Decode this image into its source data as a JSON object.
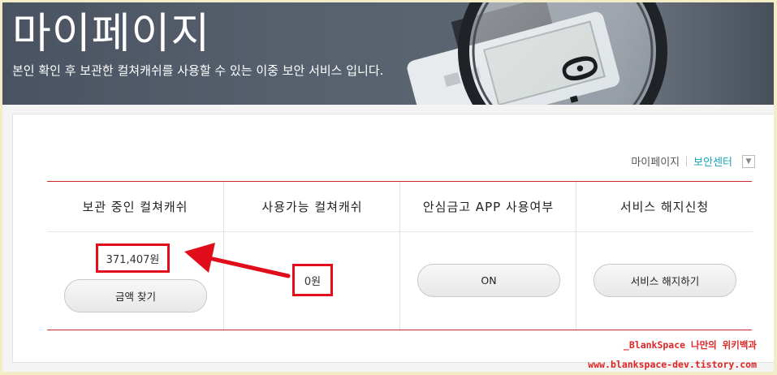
{
  "banner": {
    "title": "마이페이지",
    "subtitle": "본인 확인 후 보관한 컬쳐캐쉬를 사용할 수 있는 이중 보안 서비스 입니다.",
    "calculator_display": "0."
  },
  "breadcrumb": {
    "home": "마이페이지",
    "current": "보안센터",
    "menu_icon": "chevron-down-icon"
  },
  "table": {
    "headers": [
      "보관 중인 컬쳐캐쉬",
      "사용가능 컬쳐캐쉬",
      "안심금고 APP 사용여부",
      "서비스 해지신청"
    ],
    "stored_amount": "371,407원",
    "find_amount_button": "금액 찾기",
    "available_amount": "0원",
    "app_status_button": "ON",
    "cancel_service_button": "서비스 해지하기"
  },
  "watermark": {
    "line1": "_BlankSpace 나만의 위키백과",
    "line2": "www.blankspace-dev.tistory.com"
  },
  "colors": {
    "accent_red": "#c9252b",
    "highlight_red": "#e20d1b",
    "breadcrumb_active": "#14a7b2"
  }
}
